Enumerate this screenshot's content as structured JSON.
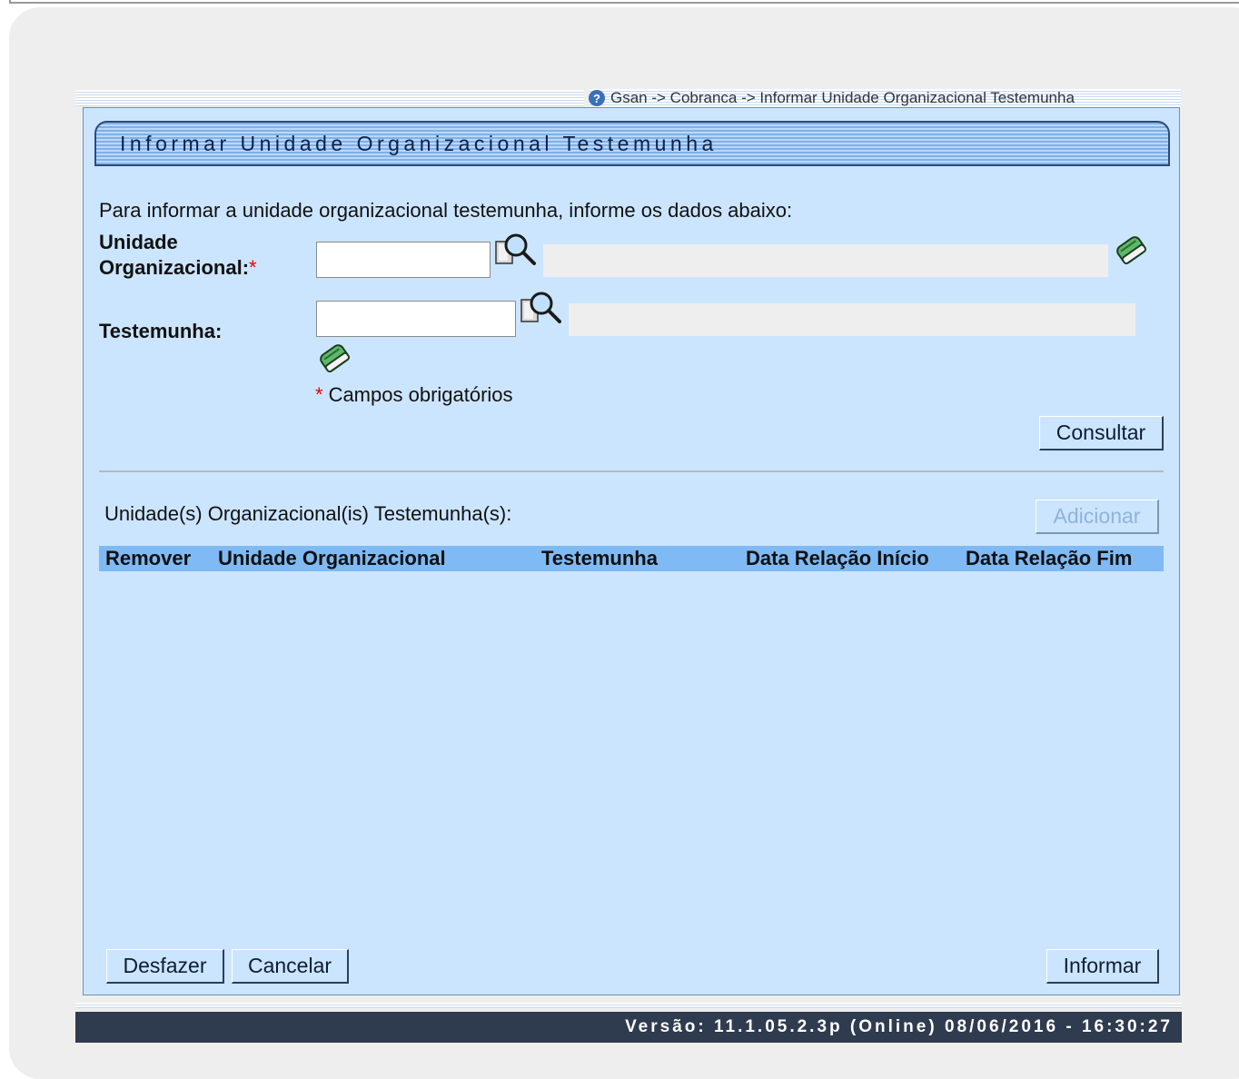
{
  "breadcrumb": {
    "text": "Gsan -> Cobranca -> Informar Unidade Organizacional Testemunha",
    "help_icon": "?"
  },
  "title": "Informar Unidade Organizacional Testemunha",
  "intro": "Para informar a unidade organizacional testemunha, informe os dados abaixo:",
  "fields": {
    "unidade_label_line1": "Unidade",
    "unidade_label_line2": "Organizacional:",
    "unidade_value": "",
    "unidade_description": "",
    "testemunha_label": "Testemunha:",
    "testemunha_value": "",
    "testemunha_description": "",
    "required_marker": "*"
  },
  "required_note": "Campos obrigatórios",
  "buttons": {
    "consultar": "Consultar",
    "adicionar": "Adicionar",
    "desfazer": "Desfazer",
    "cancelar": "Cancelar",
    "informar": "Informar"
  },
  "list": {
    "title": "Unidade(s) Organizacional(is) Testemunha(s):",
    "columns": [
      "Remover",
      "Unidade Organizacional",
      "Testemunha",
      "Data Relação Início",
      "Data Relação Fim"
    ],
    "rows": []
  },
  "footer": "Versão: 11.1.05.2.3p (Online) 08/06/2016 - 16:30:27",
  "icons": [
    "help-icon",
    "search-icon",
    "eraser-icon"
  ],
  "colors": {
    "panel": "#cce5ff",
    "header": "#7fbaf5",
    "footer": "#2f3b4e",
    "required": "#e00000"
  }
}
